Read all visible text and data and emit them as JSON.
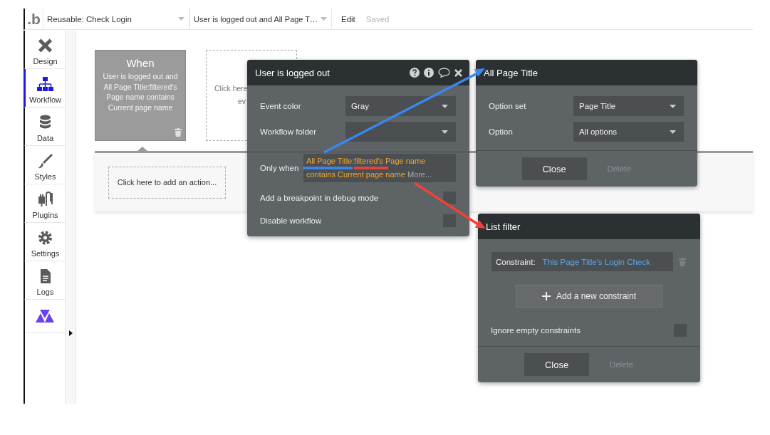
{
  "toolbar": {
    "logo": ".b",
    "page_dropdown": "Reusable: Check Login",
    "workflow_dropdown": "User is logged out and All Page T…",
    "edit_label": "Edit",
    "save_status": "Saved"
  },
  "sidebar": {
    "items": [
      {
        "kind": "design",
        "label": "Design",
        "selected": false
      },
      {
        "kind": "workflow",
        "label": "Workflow",
        "selected": true
      },
      {
        "kind": "data",
        "label": "Data",
        "selected": false
      },
      {
        "kind": "styles",
        "label": "Styles",
        "selected": false
      },
      {
        "kind": "plugins",
        "label": "Plugins",
        "selected": false
      },
      {
        "kind": "settings",
        "label": "Settings",
        "selected": false
      },
      {
        "kind": "logs",
        "label": "Logs",
        "selected": false
      }
    ]
  },
  "event_card": {
    "title": "When",
    "description": "User is logged out and All Page Title:filtered's Page name contains Current page name"
  },
  "new_event_placeholder": [
    "Click here",
    "ev"
  ],
  "action_placeholder": "Click here to add an action...",
  "event_panel": {
    "title": "User is logged out",
    "fields": [
      {
        "label": "Event color",
        "value": "Gray"
      },
      {
        "label": "Workflow folder"
      }
    ],
    "only_when": {
      "label": "Only when",
      "expression": "All Page Title:filtered's Page name contains Current page name",
      "more_link": "More..."
    },
    "toggles": [
      {
        "label": "Add a breakpoint in debug mode",
        "checked": false
      },
      {
        "label": "Disable workflow",
        "checked": false
      }
    ]
  },
  "option_panel": {
    "title": "All Page Title",
    "fields": [
      {
        "label": "Option set",
        "value": "Page Title"
      },
      {
        "label": "Option",
        "value": "All options"
      }
    ],
    "buttons": [
      {
        "label": "Close",
        "disabled": false
      },
      {
        "label": "Delete",
        "disabled": true
      }
    ]
  },
  "filter_panel": {
    "title": "List filter",
    "constraints": [
      {
        "label": "Constraint:",
        "value": "This Page Title's Login Check"
      }
    ],
    "add_button": "Add a new constraint",
    "toggles": [
      {
        "label": "Ignore empty constraints",
        "checked": false
      }
    ],
    "buttons": [
      {
        "label": "Close",
        "disabled": false
      },
      {
        "label": "Delete",
        "disabled": true
      }
    ]
  },
  "annotations": [
    {
      "color": "#3b87f0"
    },
    {
      "color": "#f0413c"
    }
  ]
}
